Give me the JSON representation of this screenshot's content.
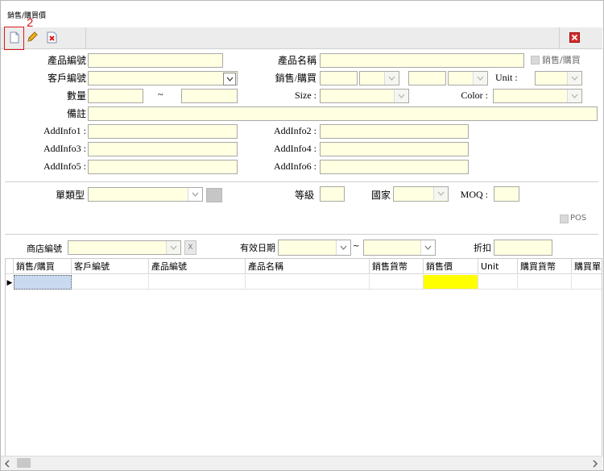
{
  "window": {
    "title": "銷售/購買價"
  },
  "toolbar": {
    "new_icon": "new-document-icon",
    "edit_icon": "pencil-icon",
    "delete_icon": "delete-icon",
    "close_icon": "close-red-icon",
    "annotation_number": "2"
  },
  "form": {
    "product_code_label": "產品編號",
    "product_name_label": "產品名稱",
    "sale_purchase_check_label": "銷售/購買",
    "customer_code_label": "客戶編號",
    "sale_purchase_label": "銷售/購買",
    "unit_label": "Unit :",
    "quantity_label": "數量",
    "tilde": "~",
    "size_label": "Size :",
    "color_label": "Color :",
    "remark_label": "備註",
    "addinfo1_label": "AddInfo1 :",
    "addinfo2_label": "AddInfo2 :",
    "addinfo3_label": "AddInfo3 :",
    "addinfo4_label": "AddInfo4 :",
    "addinfo5_label": "AddInfo5 :",
    "addinfo6_label": "AddInfo6 :",
    "doc_type_label": "單類型",
    "grade_label": "等級",
    "country_label": "國家",
    "moq_label": "MOQ :",
    "pos_label": "POS"
  },
  "filter": {
    "shop_code_label": "商店編號",
    "clear_button": "X",
    "valid_date_label": "有效日期",
    "tilde": "~",
    "discount_label": "折扣"
  },
  "grid": {
    "columns": [
      "銷售/購買",
      "客戶編號",
      "產品編號",
      "產品名稱",
      "銷售貨幣",
      "銷售價",
      "Unit",
      "購買貨幣",
      "購買單"
    ],
    "row_indicator": "▶",
    "highlight_color": "#ffff00",
    "field_color": "#ffffe1"
  }
}
